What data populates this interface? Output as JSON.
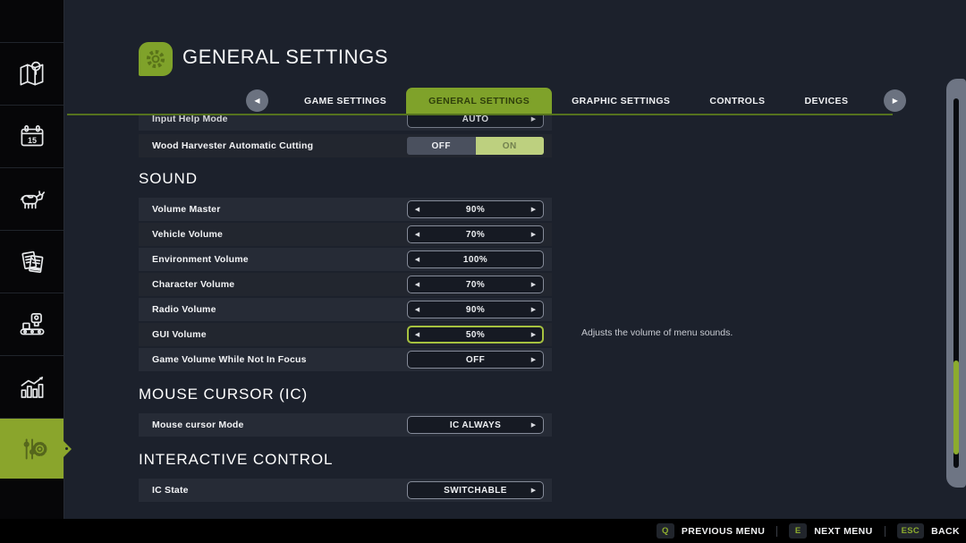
{
  "app": {
    "title": "GENERAL SETTINGS"
  },
  "tabs": {
    "items": [
      {
        "label": "GAME SETTINGS",
        "active": false
      },
      {
        "label": "GENERAL SETTINGS",
        "active": true
      },
      {
        "label": "GRAPHIC SETTINGS",
        "active": false
      },
      {
        "label": "CONTROLS",
        "active": false
      },
      {
        "label": "DEVICES",
        "active": false
      }
    ]
  },
  "sidebar": {
    "calendar_day": "15",
    "items": [
      {
        "name": "map"
      },
      {
        "name": "calendar"
      },
      {
        "name": "animals"
      },
      {
        "name": "contracts"
      },
      {
        "name": "production"
      },
      {
        "name": "statistics"
      },
      {
        "name": "settings",
        "selected": true
      }
    ]
  },
  "settings": {
    "partial_row": {
      "label": "Input Help Mode",
      "value": "AUTO"
    },
    "wood_row": {
      "label": "Wood Harvester Automatic Cutting",
      "off_label": "OFF",
      "on_label": "ON",
      "value": "ON"
    },
    "sound": {
      "title": "SOUND",
      "rows": [
        {
          "label": "Volume Master",
          "value": "90%"
        },
        {
          "label": "Vehicle Volume",
          "value": "70%"
        },
        {
          "label": "Environment Volume",
          "value": "100%"
        },
        {
          "label": "Character Volume",
          "value": "70%"
        },
        {
          "label": "Radio Volume",
          "value": "90%"
        },
        {
          "label": "GUI Volume",
          "value": "50%",
          "focused": true
        },
        {
          "label": "Game Volume While Not In Focus",
          "value": "OFF"
        }
      ]
    },
    "mouse": {
      "title": "MOUSE CURSOR (IC)",
      "rows": [
        {
          "label": "Mouse cursor Mode",
          "value": "IC ALWAYS"
        }
      ]
    },
    "ic": {
      "title": "INTERACTIVE CONTROL",
      "rows": [
        {
          "label": "IC State",
          "value": "SWITCHABLE"
        }
      ]
    }
  },
  "tooltip": {
    "text": "Adjusts the volume of menu sounds."
  },
  "footer": {
    "items": [
      {
        "key": "Q",
        "label": "PREVIOUS MENU"
      },
      {
        "key": "E",
        "label": "NEXT MENU"
      },
      {
        "key": "ESC",
        "label": "BACK"
      }
    ]
  },
  "colors": {
    "accent": "#8cab2d",
    "active_tab": "#7fa22a",
    "on_toggle": "#bdd07f",
    "sidebar_selected": "#8aa52c"
  }
}
